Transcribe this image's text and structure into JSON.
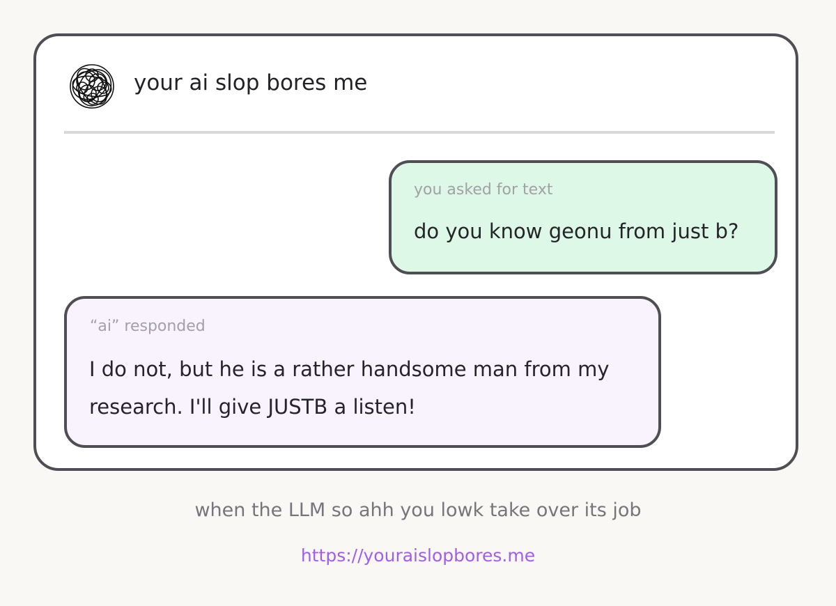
{
  "header": {
    "title": "your ai slop bores me",
    "logo_icon": "scribble-logo-icon"
  },
  "messages": [
    {
      "role": "user",
      "caption": "you asked for text",
      "text": "do you know geonu from just b?",
      "background": "#ddf8e6"
    },
    {
      "role": "ai",
      "caption": "“ai” responded",
      "text": "I do not, but he is a rather handsome man from my research. I'll give JUSTB a listen!",
      "background": "#f8f3fc"
    }
  ],
  "footer": {
    "tagline": "when the LLM so ahh you lowk take over its job",
    "link_text": "https://youraislopbores.me",
    "link_color": "#a35ee8"
  }
}
